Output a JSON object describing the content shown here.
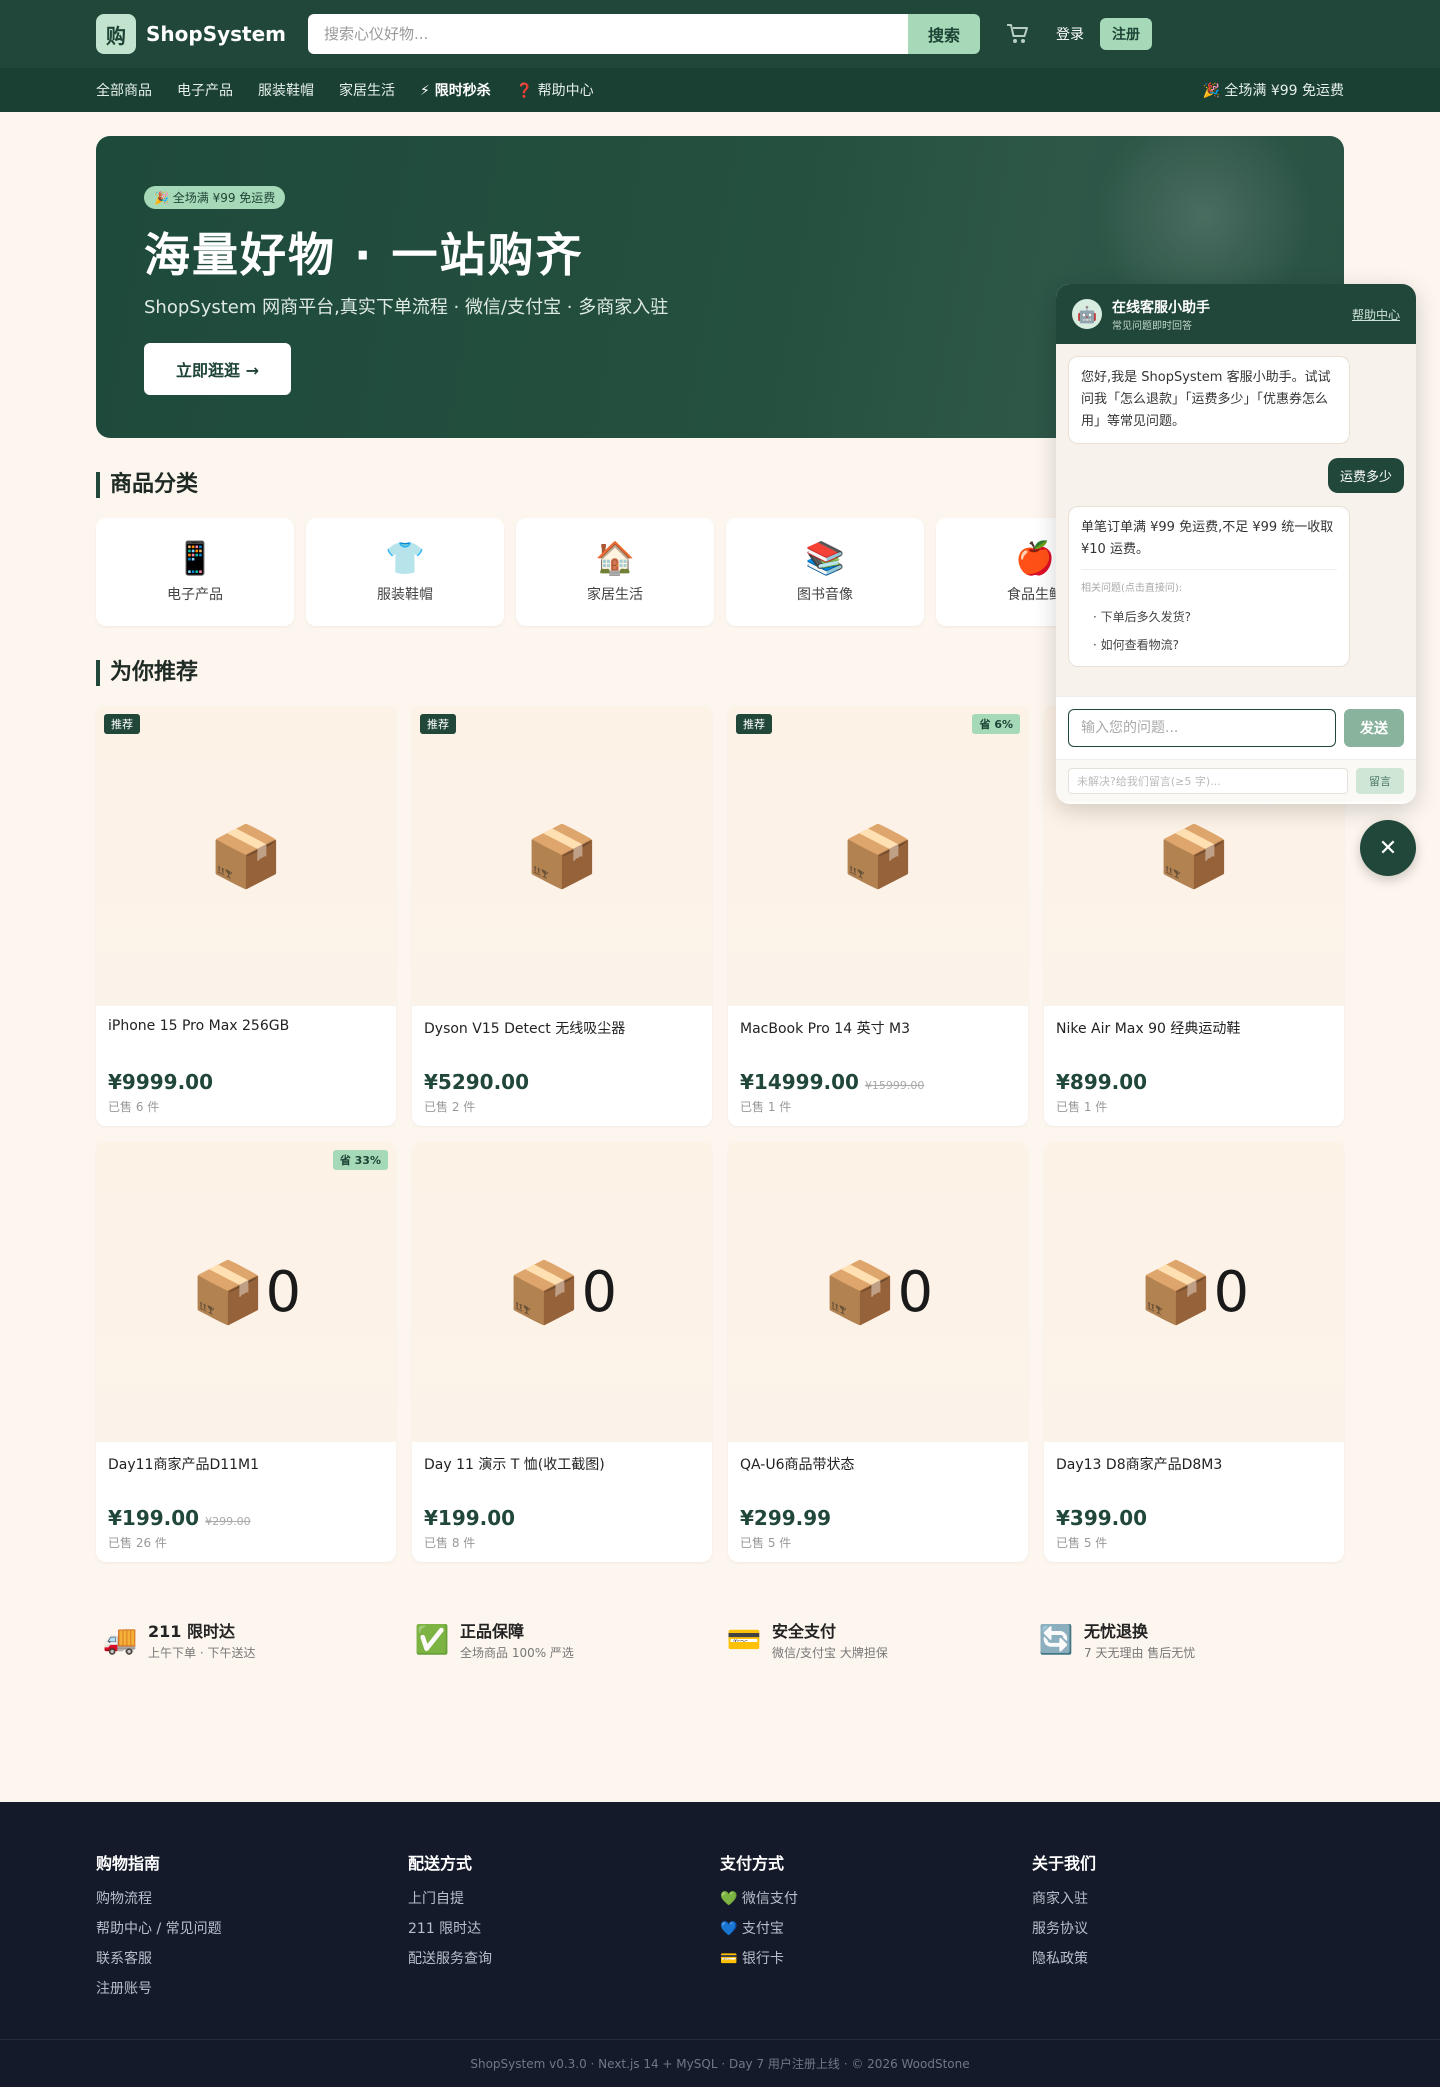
{
  "header": {
    "logo_char": "购",
    "brand": "ShopSystem",
    "search_placeholder": "搜索心仪好物...",
    "search_btn": "搜索",
    "cart_icon": "cart-icon",
    "login": "登录",
    "register": "注册"
  },
  "nav": {
    "items": [
      "全部商品",
      "电子产品",
      "服装鞋帽",
      "家居生活",
      "⚡ 限时秒杀",
      "❓ 帮助中心"
    ],
    "promo": "🎉 全场满 ¥99 免运费"
  },
  "hero": {
    "badge": "🎉 全场满 ¥99 免运费",
    "title": "海量好物 · 一站购齐",
    "subtitle": "ShopSystem 网商平台,真实下单流程 · 微信/支付宝 · 多商家入驻",
    "button": "立即逛逛 →"
  },
  "categories": {
    "title": "商品分类",
    "items": [
      {
        "icon": "📱",
        "label": "电子产品"
      },
      {
        "icon": "👕",
        "label": "服装鞋帽"
      },
      {
        "icon": "🏠",
        "label": "家居生活"
      },
      {
        "icon": "📚",
        "label": "图书音像"
      },
      {
        "icon": "🍎",
        "label": "食品生鲜"
      }
    ]
  },
  "recommend": {
    "title": "为你推荐",
    "products": [
      {
        "name": "iPhone 15 Pro Max 256GB",
        "price": "¥9999.00",
        "orig": "",
        "sold": "已售 6 件",
        "rec": "推荐",
        "save": "",
        "zero": ""
      },
      {
        "name": "Dyson V15 Detect 无线吸尘器",
        "price": "¥5290.00",
        "orig": "",
        "sold": "已售 2 件",
        "rec": "推荐",
        "save": "",
        "zero": ""
      },
      {
        "name": "MacBook Pro 14 英寸 M3",
        "price": "¥14999.00",
        "orig": "¥15999.00",
        "sold": "已售 1 件",
        "rec": "推荐",
        "save": "省 6%",
        "zero": ""
      },
      {
        "name": "Nike Air Max 90 经典运动鞋",
        "price": "¥899.00",
        "orig": "",
        "sold": "已售 1 件",
        "rec": "",
        "save": "",
        "zero": ""
      },
      {
        "name": "Day11商家产品D11M1",
        "price": "¥199.00",
        "orig": "¥299.00",
        "sold": "已售 26 件",
        "rec": "",
        "save": "省 33%",
        "zero": "0"
      },
      {
        "name": "Day 11 演示 T 恤(收工截图)",
        "price": "¥199.00",
        "orig": "",
        "sold": "已售 8 件",
        "rec": "",
        "save": "",
        "zero": "0"
      },
      {
        "name": "QA-U6商品带状态",
        "price": "¥299.99",
        "orig": "",
        "sold": "已售 5 件",
        "rec": "",
        "save": "",
        "zero": "0"
      },
      {
        "name": "Day13 D8商家产品D8M3",
        "price": "¥399.00",
        "orig": "",
        "sold": "已售 5 件",
        "rec": "",
        "save": "",
        "zero": "0"
      }
    ]
  },
  "features": [
    {
      "icon": "🚚",
      "title": "211 限时达",
      "sub": "上午下单 · 下午送达"
    },
    {
      "icon": "✅",
      "title": "正品保障",
      "sub": "全场商品 100% 严选"
    },
    {
      "icon": "💳",
      "title": "安全支付",
      "sub": "微信/支付宝 大牌担保"
    },
    {
      "icon": "🔄",
      "title": "无忧退换",
      "sub": "7 天无理由 售后无忧"
    }
  ],
  "footer": {
    "cols": [
      {
        "title": "购物指南",
        "items": [
          "购物流程",
          "帮助中心 / 常见问题",
          "联系客服",
          "注册账号"
        ]
      },
      {
        "title": "配送方式",
        "items": [
          "上门自提",
          "211 限时达",
          "配送服务查询"
        ]
      },
      {
        "title": "支付方式",
        "items": [
          "💚 微信支付",
          "💙 支付宝",
          "💳 银行卡"
        ]
      },
      {
        "title": "关于我们",
        "items": [
          "商家入驻",
          "服务协议",
          "隐私政策"
        ]
      }
    ],
    "bottom": "ShopSystem v0.3.0 · Next.js 14 + MySQL · Day 7 用户注册上线 · © 2026 WoodStone"
  },
  "chat": {
    "avatar": "🤖",
    "title": "在线客服小助手",
    "subtitle": "常见问题即时回答",
    "help": "帮助中心",
    "msg1": "您好,我是 ShopSystem 客服小助手。试试问我「怎么退款」「运费多少」「优惠券怎么用」等常见问题。",
    "user_msg": "运费多少",
    "msg2": "单笔订单满 ¥99 免运费,不足 ¥99 统一收取 ¥10 运费。",
    "related_title": "相关问题(点击直接问):",
    "related": [
      "· 下单后多久发货?",
      "· 如何查看物流?"
    ],
    "input_placeholder": "输入您的问题...",
    "send": "发送",
    "leave_placeholder": "未解决?给我们留言(≥5 字)...",
    "leave_btn": "留言",
    "close": "✕"
  }
}
